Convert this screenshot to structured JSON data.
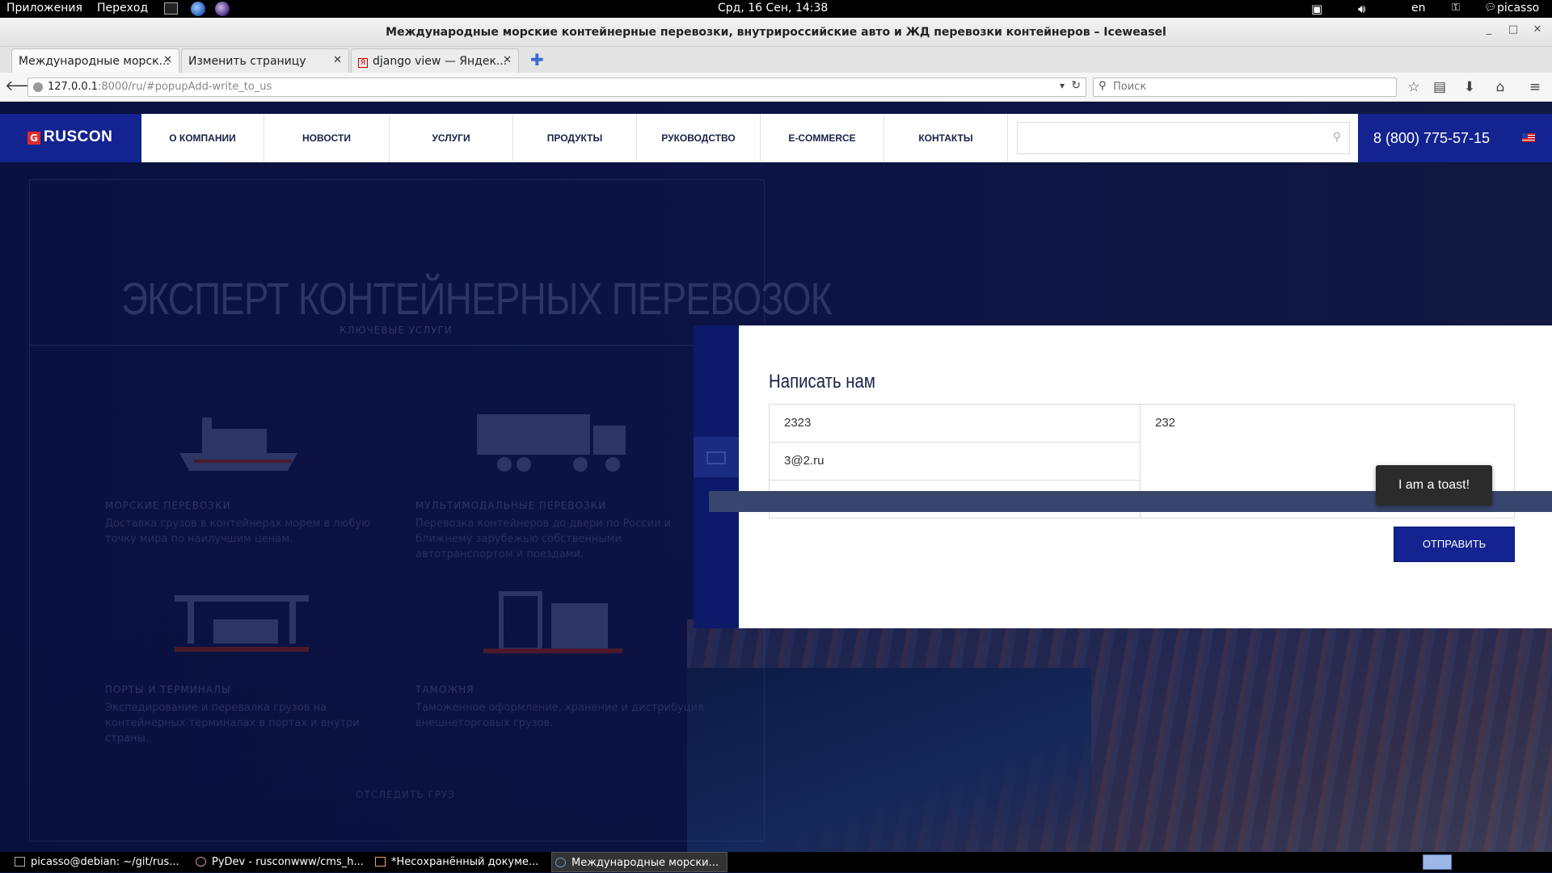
{
  "panel": {
    "apps": "Приложения",
    "places": "Переход",
    "clock": "Срд, 16 Сен, 14:38",
    "lang": "en",
    "user": "picasso"
  },
  "window": {
    "title": "Международные морские контейнерные перевозки, внутрироссийские авто и ЖД перевозки контейнеров – Iceweasel"
  },
  "tabs": [
    {
      "label": "Международные морск..."
    },
    {
      "label": "Изменить страницу"
    },
    {
      "label": "django view — Яндек..."
    }
  ],
  "navbar": {
    "url_host": "127.0.0.1",
    "url_rest": ":8000/ru/#popupAdd-write_to_us",
    "search_placeholder": "Поиск"
  },
  "site": {
    "logo": "RUSCON",
    "logo_mark": "G",
    "menu": [
      {
        "label": "О КОМПАНИИ"
      },
      {
        "label": "НОВОСТИ"
      },
      {
        "label": "УСЛУГИ"
      },
      {
        "label": "ПРОДУКТЫ"
      },
      {
        "label": "РУКОВОДСТВО"
      },
      {
        "label": "E-COMMERCE"
      },
      {
        "label": "КОНТАКТЫ"
      }
    ],
    "phone": "8 (800) 775-57-15"
  },
  "hero": {
    "title": "ЭКСПЕРТ КОНТЕЙНЕРНЫХ ПЕРЕВОЗОК",
    "subtitle": "КЛЮЧЕВЫЕ УСЛУГИ",
    "services": [
      {
        "title": "МОРСКИЕ ПЕРЕВОЗКИ",
        "desc": "Доставка грузов в контейнерах морем в любую точку мира по наилучшим ценам."
      },
      {
        "title": "МУЛЬТИМОДАЛЬНЫЕ ПЕРЕВОЗКИ",
        "desc": "Перевозка контейнеров до двери по России и ближнему зарубежью собственными автотранспортом и поездами."
      },
      {
        "title": "ПОРТЫ И ТЕРМИНАЛЫ",
        "desc": "Экспедирование и перевалка грузов на контейнерных терминалах в портах и внутри страны."
      },
      {
        "title": "ТАМОЖНЯ",
        "desc": "Таможенное оформление, хранение и дистрибуция внешнеторговых грузов."
      }
    ],
    "track_link": "ОТСЛЕДИТЬ ГРУЗ"
  },
  "popup": {
    "title": "Написать нам",
    "name_value": "2323",
    "email_value": "3@2.ru",
    "message_value": "232",
    "send_label": "ОТПРАВИТЬ"
  },
  "toast": {
    "text": "I am a toast!"
  },
  "taskbar": [
    {
      "label": "picasso@debian: ~/git/rus..."
    },
    {
      "label": "PyDev - rusconwww/cms_h..."
    },
    {
      "label": "*Несохранённый докуме..."
    },
    {
      "label": "Международные морски..."
    }
  ]
}
